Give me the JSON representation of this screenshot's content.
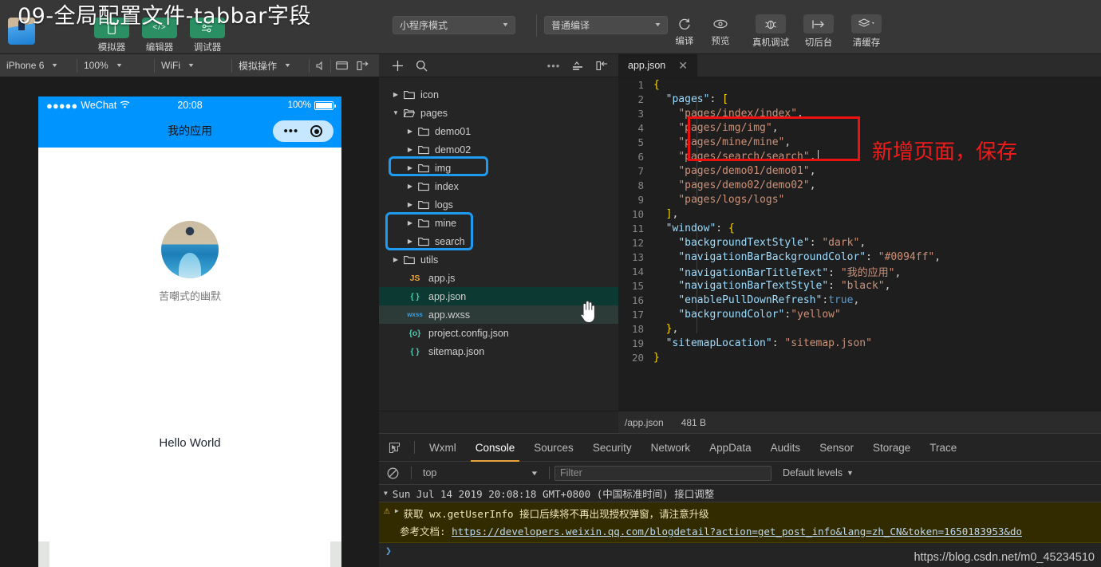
{
  "overlay_title": "09-全局配置文件-tabbar字段",
  "topbar": {
    "tools": [
      {
        "label": "模拟器",
        "icon": "phone-icon",
        "glyph": "▯"
      },
      {
        "label": "编辑器",
        "icon": "code-icon",
        "glyph": "</>"
      },
      {
        "label": "调试器",
        "icon": "debugger-icon",
        "glyph": "⚟"
      }
    ],
    "mode_select": "小程序模式",
    "compile_select": "普通编译",
    "compile_label": "编译",
    "preview_label": "预览",
    "buttons": [
      {
        "label": "真机调试",
        "icon": "bug-icon"
      },
      {
        "label": "切后台",
        "icon": "background-icon"
      },
      {
        "label": "清缓存",
        "icon": "layers-icon"
      }
    ]
  },
  "simbar": {
    "device": "iPhone 6",
    "zoom": "100%",
    "network": "WiFi",
    "simulate": "模拟操作",
    "icons": [
      "volume-icon",
      "window-icon",
      "detach-icon"
    ]
  },
  "filebar": {
    "icons": [
      "add-icon",
      "search-icon",
      "more-icon",
      "sort-icon",
      "collapse-icon"
    ]
  },
  "tabs": [
    {
      "label": "app.json",
      "close": "✕"
    }
  ],
  "simulator": {
    "carrier": "WeChat",
    "dots": "●●●●●",
    "wifi": "≋",
    "time": "20:08",
    "battery_pct": "100%",
    "nav_title": "我的应用",
    "user_name": "苦嘲式的幽默",
    "hello": "Hello World"
  },
  "tree": [
    {
      "name": "icon",
      "type": "folder",
      "indent": 1,
      "expanded": false,
      "state": ""
    },
    {
      "name": "pages",
      "type": "folder-open",
      "indent": 1,
      "expanded": true,
      "state": ""
    },
    {
      "name": "demo01",
      "type": "folder",
      "indent": 2,
      "expanded": false,
      "state": ""
    },
    {
      "name": "demo02",
      "type": "folder",
      "indent": 2,
      "expanded": false,
      "state": ""
    },
    {
      "name": "img",
      "type": "folder",
      "indent": 2,
      "expanded": false,
      "state": ""
    },
    {
      "name": "index",
      "type": "folder",
      "indent": 2,
      "expanded": false,
      "state": ""
    },
    {
      "name": "logs",
      "type": "folder",
      "indent": 2,
      "expanded": false,
      "state": ""
    },
    {
      "name": "mine",
      "type": "folder",
      "indent": 2,
      "expanded": false,
      "state": ""
    },
    {
      "name": "search",
      "type": "folder",
      "indent": 2,
      "expanded": false,
      "state": ""
    },
    {
      "name": "utils",
      "type": "folder",
      "indent": 1,
      "expanded": false,
      "state": ""
    },
    {
      "name": "app.js",
      "type": "js",
      "indent": 2,
      "badge": "JS",
      "state": ""
    },
    {
      "name": "app.json",
      "type": "json",
      "indent": 2,
      "badge": "{ }",
      "state": "selected"
    },
    {
      "name": "app.wxss",
      "type": "wxss",
      "indent": 2,
      "badge": "wxss",
      "state": "hover"
    },
    {
      "name": "project.config.json",
      "type": "config",
      "indent": 2,
      "badge": "{o}",
      "state": ""
    },
    {
      "name": "sitemap.json",
      "type": "json",
      "indent": 2,
      "badge": "{ }",
      "state": ""
    }
  ],
  "code_lines": [
    {
      "n": "1",
      "text": "{"
    },
    {
      "n": "2",
      "text": "  \"pages\": ["
    },
    {
      "n": "3",
      "text": "    \"pages/index/index\","
    },
    {
      "n": "4",
      "text": "    \"pages/img/img\","
    },
    {
      "n": "5",
      "text": "    \"pages/mine/mine\","
    },
    {
      "n": "6",
      "text": "    \"pages/search/search\","
    },
    {
      "n": "7",
      "text": "    \"pages/demo01/demo01\","
    },
    {
      "n": "8",
      "text": "    \"pages/demo02/demo02\","
    },
    {
      "n": "9",
      "text": "    \"pages/logs/logs\""
    },
    {
      "n": "10",
      "text": "  ],"
    },
    {
      "n": "11",
      "text": "  \"window\": {"
    },
    {
      "n": "12",
      "text": "    \"backgroundTextStyle\": \"dark\","
    },
    {
      "n": "13",
      "text": "    \"navigationBarBackgroundColor\": \"#0094ff\","
    },
    {
      "n": "14",
      "text": "    \"navigationBarTitleText\": \"我的应用\","
    },
    {
      "n": "15",
      "text": "    \"navigationBarTextStyle\": \"black\","
    },
    {
      "n": "16",
      "text": "    \"enablePullDownRefresh\":true,"
    },
    {
      "n": "17",
      "text": "    \"backgroundColor\":\"yellow\""
    },
    {
      "n": "18",
      "text": "  },"
    },
    {
      "n": "19",
      "text": "  \"sitemapLocation\": \"sitemap.json\""
    },
    {
      "n": "20",
      "text": "}"
    }
  ],
  "annotation": "新增页面，保存",
  "statusline": {
    "path": "/app.json",
    "size": "481 B"
  },
  "devtools": {
    "tabs": [
      "Wxml",
      "Console",
      "Sources",
      "Security",
      "Network",
      "AppData",
      "Audits",
      "Sensor",
      "Storage",
      "Trace"
    ],
    "active_tab": "Console",
    "context": "top",
    "filter_placeholder": "Filter",
    "levels": "Default levels",
    "console": {
      "header": "Sun Jul 14 2019 20:08:18 GMT+0800 (中国标准时间) 接口调整",
      "warning_line1": "获取 wx.getUserInfo 接口后续将不再出现授权弹窗，请注意升级",
      "warning_line2_label": "参考文档:",
      "warning_link": "https://developers.weixin.qq.com/blogdetail?action=get_post_info&lang=zh_CN&token=1650183953&do",
      "prompt": "❯"
    }
  },
  "watermark": "https://blog.csdn.net/m0_45234510",
  "colors": {
    "accent_blue": "#0094ff",
    "annotation_red": "#f21b1b",
    "highlight_blue": "#1e9bf0",
    "tab_underline": "#e8a33d"
  }
}
